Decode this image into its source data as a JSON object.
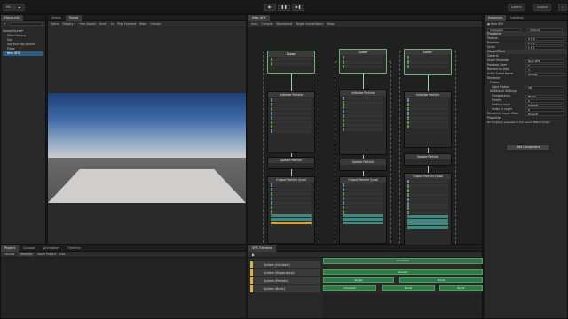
{
  "topbar": {
    "account": "MC",
    "play": "▶",
    "pause": "❚❚",
    "step": "▶❚",
    "layers": "Layers",
    "layout": "Layout"
  },
  "hierarchy": {
    "tab": "Hierarchy",
    "add": "+",
    "items": [
      "SampleScene*",
      "Main Camera",
      "Sun",
      "Sky and Fog Volume",
      "Plane",
      "New VFX"
    ]
  },
  "scene": {
    "tabs": [
      "Scene",
      "Game"
    ],
    "toolbar": [
      "Game",
      "Display 1",
      "Free Aspect",
      "Scale",
      "1x",
      "Play Focused",
      "Stats",
      "Gizmos"
    ]
  },
  "vfx_graph": {
    "tab": "New VFX",
    "toolbar": [
      "Auto",
      "Compile",
      "Blackboard",
      "Target GameObject",
      "Show"
    ],
    "systems": [
      {
        "spawn": "Spawn",
        "init": "Initialize Particle",
        "update": "Update Particle",
        "output": "Output Particle Quad"
      },
      {
        "spawn": "Spawn",
        "init": "Initialize Particle",
        "update": "Update Particle",
        "output": "Output Particle Quad"
      },
      {
        "spawn": "Spawn",
        "init": "Initialize Particle",
        "update": "Update Particle",
        "output": "Output Particle Quad"
      }
    ]
  },
  "inspector": {
    "tabs": [
      "Inspector",
      "Lighting"
    ],
    "object_name": "New VFX",
    "tag": "Untagged",
    "layer": "Default",
    "sections": [
      "Transform",
      "Visual Effect"
    ],
    "transform": [
      {
        "label": "Position",
        "value": "0   0   0"
      },
      {
        "label": "Rotation",
        "value": "0   0   0"
      },
      {
        "label": "Scale",
        "value": "1   1   1"
      }
    ],
    "vfx_rows": [
      {
        "label": "General",
        "value": ""
      },
      {
        "label": "Asset Template",
        "value": "New VFX"
      },
      {
        "label": "Random Seed",
        "value": "0"
      },
      {
        "label": "Reseed on play",
        "value": "✓"
      },
      {
        "label": "Initial Event Name",
        "value": "OnPlay"
      },
      {
        "label": "Renderer",
        "value": ""
      },
      {
        "label": "Probes",
        "value": ""
      },
      {
        "label": "Light Probes",
        "value": "Off"
      },
      {
        "label": "Additional Settings",
        "value": ""
      },
      {
        "label": "Transparency",
        "value": "Blend"
      },
      {
        "label": "Priority",
        "value": "0"
      },
      {
        "label": "Sorting Layer",
        "value": "Default"
      },
      {
        "label": "Order in Layer",
        "value": "0"
      },
      {
        "label": "Rendering Layer Mask",
        "value": "Default"
      },
      {
        "label": "Properties",
        "value": ""
      }
    ],
    "note": "No Property exposed in the Visual Effect Graph",
    "add_component": "Add Component"
  },
  "project": {
    "tabs": [
      "Project",
      "Console",
      "Animation",
      "Timeline"
    ],
    "toolbar": [
      "Preview",
      "Timeline",
      "Stitch Project",
      "Edit"
    ]
  },
  "timeline": {
    "tab": "VFX Timeline",
    "tracks": [
      "System (Constant)",
      "System (Single-burst)",
      "System (Periodic)",
      "System (Burst)"
    ],
    "clips": [
      "Periodic",
      "Single",
      "Burst",
      "Constant",
      "Burst",
      "Burst"
    ],
    "header_clip": "Constant"
  },
  "colors": {
    "accent": "#2c5d87",
    "track": "#d9b24a",
    "clip": "#2f7a43"
  }
}
